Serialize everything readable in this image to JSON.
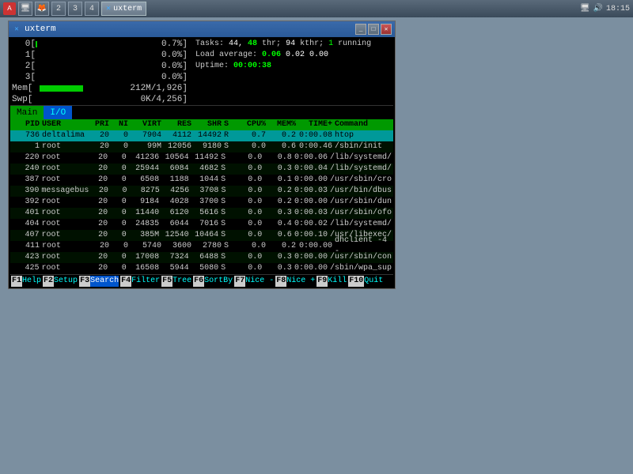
{
  "taskbar": {
    "buttons": [
      {
        "label": "A",
        "type": "icon",
        "color": "#c0392b"
      },
      {
        "label": "",
        "type": "icon-monitor"
      },
      {
        "label": "",
        "type": "icon-browser"
      },
      {
        "label": "2",
        "active": false
      },
      {
        "label": "3",
        "active": false
      },
      {
        "label": "4",
        "active": false
      },
      {
        "label": "uxterm",
        "active": true
      }
    ],
    "right": {
      "icons": [
        "monitor-icon",
        "audio-icon"
      ],
      "time": "18:15"
    }
  },
  "window": {
    "title": "uxterm",
    "title_icon": "X",
    "controls": [
      "minimize",
      "maximize",
      "close"
    ]
  },
  "cpu_bars": [
    {
      "label": "0[",
      "bar": 2,
      "percent": "0.7%]"
    },
    {
      "label": "1[",
      "bar": 0,
      "percent": "0.0%]"
    },
    {
      "label": "2[",
      "bar": 0,
      "percent": "0.0%]"
    },
    {
      "label": "3[",
      "bar": 0,
      "percent": "0.0%]"
    }
  ],
  "mem_bars": [
    {
      "label": "Mem[",
      "bar": 60,
      "value": "212M/1,926]"
    },
    {
      "label": "Swp[",
      "bar": 0,
      "value": "0K/4,256]"
    }
  ],
  "system_info": {
    "tasks_label": "Tasks:",
    "tasks_value": "44,",
    "thr_value": "48",
    "thr_label": "thr;",
    "kthr_value": "94",
    "kthr_label": "kthr;",
    "running_value": "1",
    "running_label": "running",
    "load_label": "Load average:",
    "load1": "0.06",
    "load5": "0.02",
    "load15": "0.00",
    "uptime_label": "Uptime:",
    "uptime_value": "00:00:38"
  },
  "tabs": [
    {
      "label": "Main",
      "active": false
    },
    {
      "label": "I/O",
      "active": true
    }
  ],
  "table_headers": [
    "PID",
    "USER",
    "PRI",
    "NI",
    "VIRT",
    "RES",
    "SHR",
    "S",
    "CPU%",
    "MEM%",
    "TIME+",
    "Command"
  ],
  "processes": [
    {
      "pid": "736",
      "user": "deltalima",
      "pri": "20",
      "ni": "0",
      "virt": "7904",
      "res": "4112",
      "shr": "14492",
      "s": "R",
      "cpu": "0.7",
      "mem": "0.2",
      "time": "0:00.08",
      "cmd": "htop",
      "highlight": true
    },
    {
      "pid": "1",
      "user": "root",
      "pri": "20",
      "ni": "0",
      "virt": "99M",
      "res": "12056",
      "shr": "9180",
      "s": "S",
      "cpu": "0.0",
      "mem": "0.6",
      "time": "0:00.46",
      "cmd": "/sbin/init"
    },
    {
      "pid": "220",
      "user": "root",
      "pri": "20",
      "ni": "0",
      "virt": "41236",
      "res": "10564",
      "shr": "11492",
      "s": "S",
      "cpu": "0.0",
      "mem": "0.8",
      "time": "0:00.06",
      "cmd": "/lib/systemd/"
    },
    {
      "pid": "240",
      "user": "root",
      "pri": "20",
      "ni": "0",
      "virt": "25944",
      "res": "6084",
      "shr": "4682",
      "s": "S",
      "cpu": "0.0",
      "mem": "0.3",
      "time": "0:00.04",
      "cmd": "/lib/systemd/"
    },
    {
      "pid": "387",
      "user": "root",
      "pri": "20",
      "ni": "0",
      "virt": "6508",
      "res": "1188",
      "shr": "1044",
      "s": "S",
      "cpu": "0.0",
      "mem": "0.1",
      "time": "0:00.00",
      "cmd": "/usr/sbin/cro"
    },
    {
      "pid": "390",
      "user": "messagebus",
      "pri": "20",
      "ni": "0",
      "virt": "8275",
      "res": "4256",
      "shr": "3708",
      "s": "S",
      "cpu": "0.0",
      "mem": "0.2",
      "time": "0:00.03",
      "cmd": "/usr/bin/dbus"
    },
    {
      "pid": "392",
      "user": "root",
      "pri": "20",
      "ni": "0",
      "virt": "9184",
      "res": "4028",
      "shr": "3700",
      "s": "S",
      "cpu": "0.0",
      "mem": "0.2",
      "time": "0:00.00",
      "cmd": "/usr/sbin/dun"
    },
    {
      "pid": "401",
      "user": "root",
      "pri": "20",
      "ni": "0",
      "virt": "11440",
      "res": "6120",
      "shr": "5616",
      "s": "S",
      "cpu": "0.0",
      "mem": "0.3",
      "time": "0:00.03",
      "cmd": "/usr/sbin/ofo"
    },
    {
      "pid": "404",
      "user": "root",
      "pri": "20",
      "ni": "0",
      "virt": "24835",
      "res": "6044",
      "shr": "7016",
      "s": "S",
      "cpu": "0.0",
      "mem": "0.4",
      "time": "0:00.02",
      "cmd": "/lib/systemd/"
    },
    {
      "pid": "407",
      "user": "root",
      "pri": "20",
      "ni": "0",
      "virt": "385M",
      "res": "12540",
      "shr": "10464",
      "s": "S",
      "cpu": "0.0",
      "mem": "0.6",
      "time": "0:00.10",
      "cmd": "/usr/libexec/"
    },
    {
      "pid": "411",
      "user": "root",
      "pri": "20",
      "ni": "0",
      "virt": "5740",
      "res": "3600",
      "shr": "2780",
      "s": "S",
      "cpu": "0.0",
      "mem": "0.2",
      "time": "0:00.00",
      "cmd": "dhclient -4 -"
    },
    {
      "pid": "423",
      "user": "root",
      "pri": "20",
      "ni": "0",
      "virt": "17008",
      "res": "7324",
      "shr": "6488",
      "s": "S",
      "cpu": "0.0",
      "mem": "0.3",
      "time": "0:00.00",
      "cmd": "/usr/sbin/con"
    },
    {
      "pid": "425",
      "user": "root",
      "pri": "20",
      "ni": "0",
      "virt": "16508",
      "res": "5944",
      "shr": "5080",
      "s": "S",
      "cpu": "0.0",
      "mem": "0.3",
      "time": "0:00.00",
      "cmd": "/sbin/wpa_sup"
    }
  ],
  "func_keys": [
    {
      "num": "F1",
      "label": "Help"
    },
    {
      "num": "F2",
      "label": "Setup"
    },
    {
      "num": "F3",
      "label": "Search"
    },
    {
      "num": "F4",
      "label": "Filter"
    },
    {
      "num": "F5",
      "label": "Tree"
    },
    {
      "num": "F6",
      "label": "SortBy"
    },
    {
      "num": "F7",
      "label": "Nice -"
    },
    {
      "num": "F8",
      "label": "Nice +"
    },
    {
      "num": "F9",
      "label": "Kill"
    },
    {
      "num": "F10",
      "label": "Quit"
    }
  ]
}
